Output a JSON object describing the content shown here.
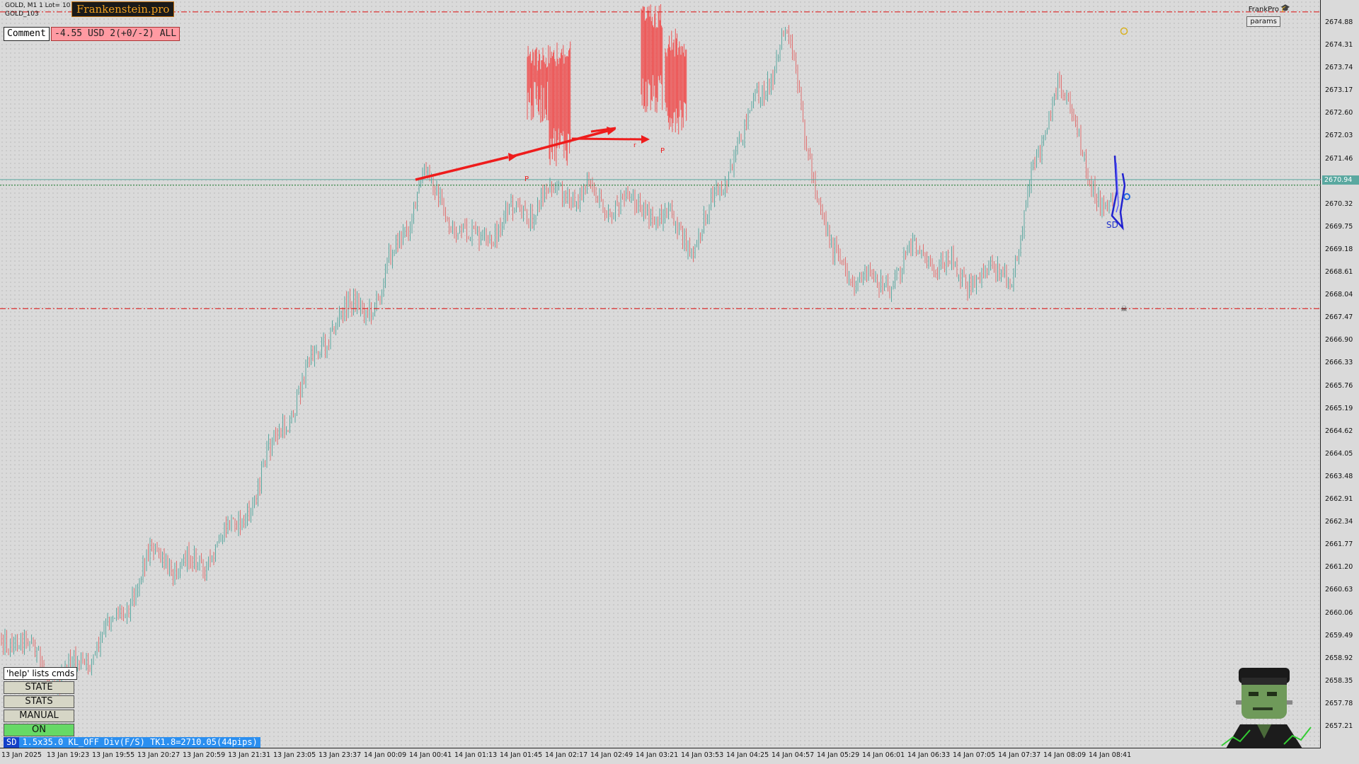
{
  "header": {
    "symbol_line1": "GOLD, M1  1 Lot= 10",
    "symbol_line2": "GOLD_103",
    "brand": "Frankenstein.pro",
    "comment_label": "Comment",
    "pnl_text": "-4.55 USD 2(+0/-2) ALL",
    "frank_label": "FrankPro",
    "params_label": "params"
  },
  "price_axis": {
    "labels": [
      "2674.88",
      "2674.31",
      "2673.74",
      "2673.17",
      "2672.60",
      "2672.03",
      "2671.46",
      "2670.32",
      "2669.75",
      "2669.18",
      "2668.61",
      "2668.04",
      "2667.47",
      "2666.90",
      "2666.33",
      "2665.76",
      "2665.19",
      "2664.62",
      "2664.05",
      "2663.48",
      "2662.91",
      "2662.34",
      "2661.77",
      "2661.20",
      "2660.63",
      "2660.06",
      "2659.49",
      "2658.92",
      "2658.35",
      "2657.78",
      "2657.21"
    ],
    "current_price": "2670.94"
  },
  "time_axis": {
    "labels": [
      "13 Jan 2025",
      "13 Jan 19:23",
      "13 Jan 19:55",
      "13 Jan 20:27",
      "13 Jan 20:59",
      "13 Jan 21:31",
      "13 Jan 23:05",
      "13 Jan 23:37",
      "14 Jan 00:09",
      "14 Jan 00:41",
      "14 Jan 01:13",
      "14 Jan 01:45",
      "14 Jan 02:17",
      "14 Jan 02:49",
      "14 Jan 03:21",
      "14 Jan 03:53",
      "14 Jan 04:25",
      "14 Jan 04:57",
      "14 Jan 05:29",
      "14 Jan 06:01",
      "14 Jan 06:33",
      "14 Jan 07:05",
      "14 Jan 07:37",
      "14 Jan 08:09",
      "14 Jan 08:41"
    ]
  },
  "chart_data": {
    "type": "candlestick",
    "symbol": "GOLD",
    "timeframe": "M1",
    "current_price": 2670.94,
    "ylim": [
      2656.9,
      2675.2
    ],
    "key_points": [
      {
        "time": "13 Jan 2025",
        "price": 2659.5
      },
      {
        "time": "13 Jan 19:23",
        "price": 2658.3
      },
      {
        "time": "13 Jan 19:55",
        "price": 2659.5
      },
      {
        "time": "13 Jan 20:27",
        "price": 2661.5
      },
      {
        "time": "13 Jan 20:59",
        "price": 2661.2
      },
      {
        "time": "13 Jan 21:31",
        "price": 2662.4
      },
      {
        "time": "13 Jan 23:05",
        "price": 2665.0
      },
      {
        "time": "13 Jan 23:37",
        "price": 2667.4
      },
      {
        "time": "14 Jan 00:09",
        "price": 2668.0
      },
      {
        "time": "14 Jan 00:41",
        "price": 2671.0
      },
      {
        "time": "14 Jan 01:13",
        "price": 2669.3
      },
      {
        "time": "14 Jan 01:45",
        "price": 2670.0
      },
      {
        "time": "14 Jan 02:17",
        "price": 2670.7
      },
      {
        "time": "14 Jan 02:49",
        "price": 2670.4
      },
      {
        "time": "14 Jan 03:21",
        "price": 2670.2
      },
      {
        "time": "14 Jan 03:53",
        "price": 2669.3
      },
      {
        "time": "14 Jan 04:25",
        "price": 2671.9
      },
      {
        "time": "14 Jan 04:57",
        "price": 2674.6
      },
      {
        "time": "14 Jan 05:29",
        "price": 2669.0
      },
      {
        "time": "14 Jan 06:01",
        "price": 2668.2
      },
      {
        "time": "14 Jan 06:33",
        "price": 2669.2
      },
      {
        "time": "14 Jan 07:05",
        "price": 2668.4
      },
      {
        "time": "14 Jan 07:37",
        "price": 2668.7
      },
      {
        "time": "14 Jan 08:09",
        "price": 2673.5
      },
      {
        "time": "14 Jan 08:41",
        "price": 2670.2
      }
    ],
    "horizontal_levels": [
      {
        "price": 2675.15,
        "style": "dash-dot",
        "color": "#dd2222"
      },
      {
        "price": 2670.94,
        "style": "solid",
        "color": "#5aa8a0"
      },
      {
        "price": 2670.8,
        "style": "dotted",
        "color": "#3a8a4a"
      },
      {
        "price": 2667.7,
        "style": "dash-dot",
        "color": "#dd2222"
      }
    ],
    "bull_color": "#5aa8a0",
    "bear_color": "#e07070"
  },
  "panel": {
    "help_label": "'help' lists cmds",
    "buttons": [
      "STATE",
      "STATS",
      "MANUAL",
      "ON"
    ],
    "status_tag": "SD",
    "status_text": "1.5x35.0 KL_OFF Div(F/S) TK1.8=2710.05(44pips)"
  },
  "annotations": {
    "sd_label": "SD"
  }
}
